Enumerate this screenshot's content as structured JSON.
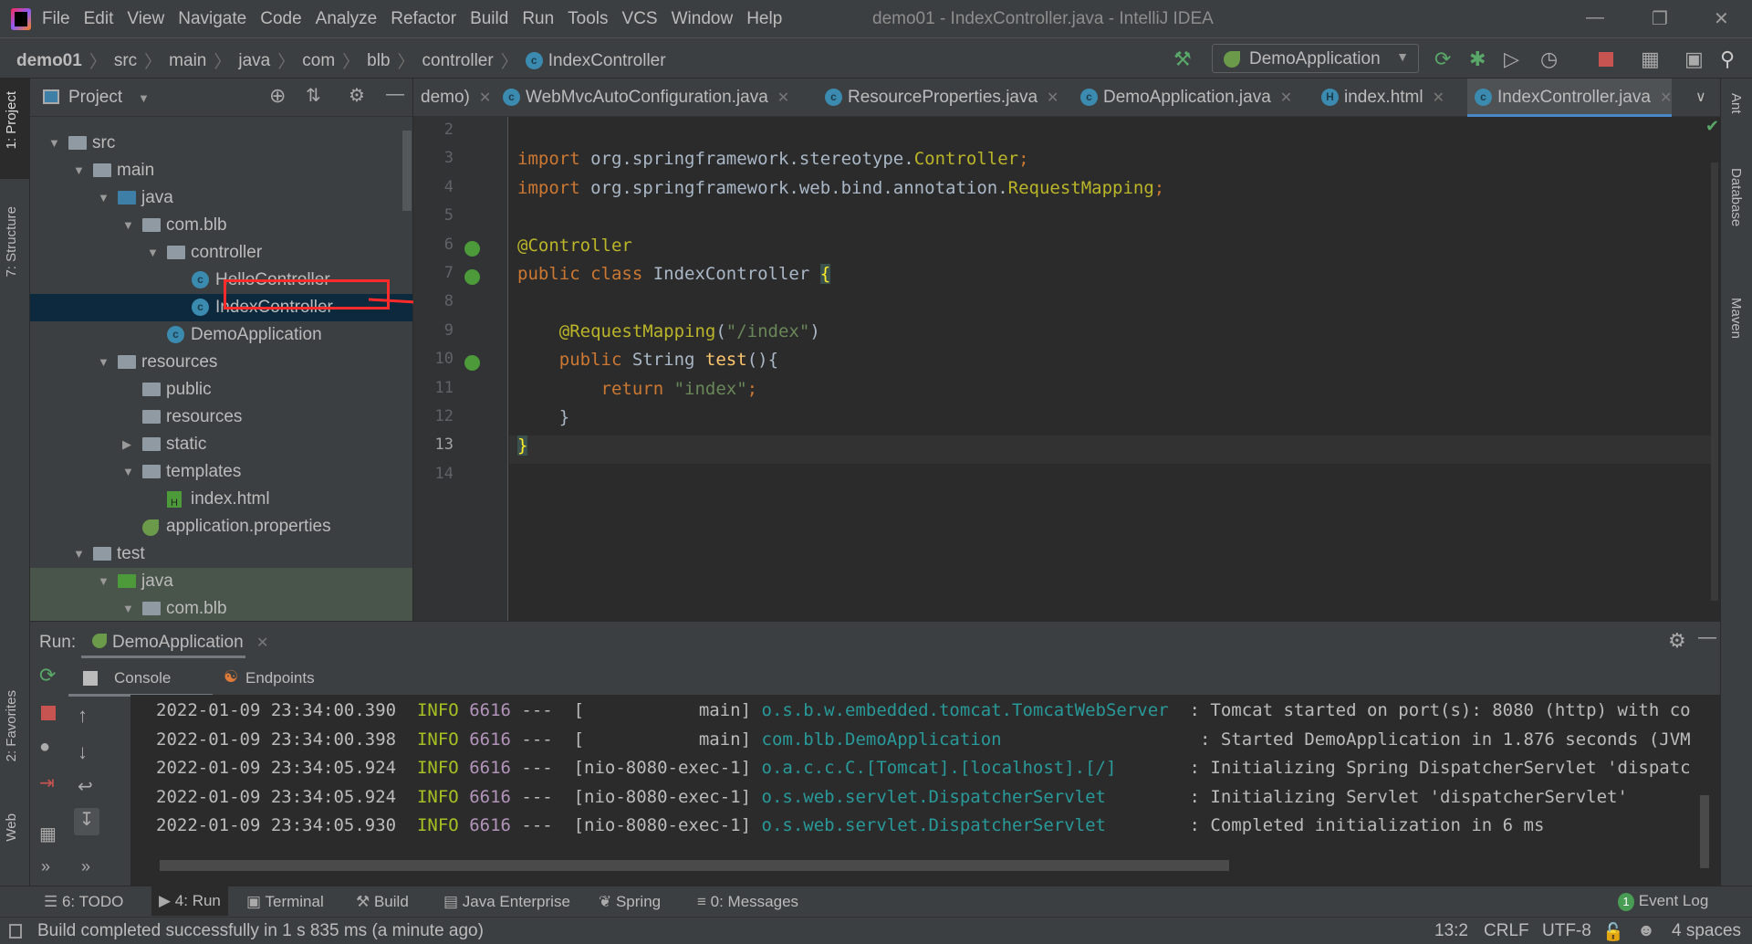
{
  "window": {
    "title": "demo01 - IndexController.java - IntelliJ IDEA"
  },
  "menu": [
    "File",
    "Edit",
    "View",
    "Navigate",
    "Code",
    "Analyze",
    "Refactor",
    "Build",
    "Run",
    "Tools",
    "VCS",
    "Window",
    "Help"
  ],
  "breadcrumb": {
    "project": "demo01",
    "items": [
      "src",
      "main",
      "java",
      "com",
      "blb",
      "controller",
      "IndexController"
    ]
  },
  "toolbar": {
    "run_config": "DemoApplication"
  },
  "left_stripe": {
    "project": "1: Project",
    "structure": "7: Structure",
    "favorites": "2: Favorites",
    "web": "Web"
  },
  "right_stripe": {
    "ant": "Ant",
    "database": "Database",
    "maven": "Maven"
  },
  "project_panel": {
    "title": "Project",
    "tree": [
      {
        "label": "src",
        "level": 0,
        "expanded": true,
        "type": "folder"
      },
      {
        "label": "main",
        "level": 1,
        "expanded": true,
        "type": "folder"
      },
      {
        "label": "java",
        "level": 2,
        "expanded": true,
        "type": "src-folder"
      },
      {
        "label": "com.blb",
        "level": 3,
        "expanded": true,
        "type": "package"
      },
      {
        "label": "controller",
        "level": 4,
        "expanded": true,
        "type": "package"
      },
      {
        "label": "HelloController",
        "level": 5,
        "type": "class"
      },
      {
        "label": "IndexController",
        "level": 5,
        "type": "class",
        "selected": true
      },
      {
        "label": "DemoApplication",
        "level": 4,
        "type": "spring-class"
      },
      {
        "label": "resources",
        "level": 2,
        "expanded": true,
        "type": "res-folder"
      },
      {
        "label": "public",
        "level": 3,
        "type": "folder"
      },
      {
        "label": "resources",
        "level": 3,
        "type": "folder"
      },
      {
        "label": "static",
        "level": 3,
        "expanded": false,
        "type": "folder"
      },
      {
        "label": "templates",
        "level": 3,
        "expanded": true,
        "type": "folder"
      },
      {
        "label": "index.html",
        "level": 4,
        "type": "html"
      },
      {
        "label": "application.properties",
        "level": 3,
        "type": "properties"
      },
      {
        "label": "test",
        "level": 1,
        "expanded": true,
        "type": "folder"
      },
      {
        "label": "java",
        "level": 2,
        "expanded": true,
        "type": "test-folder",
        "test": true
      },
      {
        "label": "com.blb",
        "level": 3,
        "expanded": true,
        "type": "package",
        "test": true
      }
    ]
  },
  "editor": {
    "tabs": [
      {
        "label": "demo)"
      },
      {
        "label": "WebMvcAutoConfiguration.java"
      },
      {
        "label": "ResourceProperties.java"
      },
      {
        "label": "DemoApplication.java"
      },
      {
        "label": "index.html"
      },
      {
        "label": "IndexController.java",
        "active": true
      }
    ],
    "lines": [
      {
        "n": "2",
        "tokens": []
      },
      {
        "n": "3",
        "tokens": [
          [
            "import ",
            "kw"
          ],
          [
            "org.springframework.stereotype.",
            ""
          ],
          [
            "Controller",
            "ann"
          ],
          [
            ";",
            "kw"
          ]
        ]
      },
      {
        "n": "4",
        "tokens": [
          [
            "import ",
            "kw"
          ],
          [
            "org.springframework.web.bind.annotation.",
            ""
          ],
          [
            "RequestMapping",
            "ann"
          ],
          [
            ";",
            "kw"
          ]
        ]
      },
      {
        "n": "5",
        "tokens": []
      },
      {
        "n": "6",
        "tokens": [
          [
            "@Controller",
            "ann"
          ]
        ]
      },
      {
        "n": "7",
        "tokens": [
          [
            "public class ",
            "kw"
          ],
          [
            "IndexController ",
            ""
          ],
          [
            "{",
            "br"
          ]
        ]
      },
      {
        "n": "8",
        "tokens": []
      },
      {
        "n": "9",
        "tokens": [
          [
            "    @RequestMapping",
            "ann"
          ],
          [
            "(",
            ""
          ],
          [
            "\"/index\"",
            "str"
          ],
          [
            ")",
            ""
          ]
        ]
      },
      {
        "n": "10",
        "tokens": [
          [
            "    public ",
            "kw"
          ],
          [
            "String ",
            ""
          ],
          [
            "test",
            "fn"
          ],
          [
            "(){",
            ""
          ]
        ]
      },
      {
        "n": "11",
        "tokens": [
          [
            "        return ",
            "kw"
          ],
          [
            "\"index\"",
            "str"
          ],
          [
            ";",
            "kw"
          ]
        ]
      },
      {
        "n": "12",
        "tokens": [
          [
            "    }",
            ""
          ]
        ]
      },
      {
        "n": "13",
        "tokens": [
          [
            "}",
            "br"
          ]
        ],
        "current": true
      },
      {
        "n": "14",
        "tokens": []
      }
    ]
  },
  "run_panel": {
    "label": "Run:",
    "config_tab": "DemoApplication",
    "tabs": [
      "Console",
      "Endpoints"
    ],
    "console": [
      {
        "ts": "2022-01-09 23:34:00.390",
        "level": "INFO",
        "pid": "6616",
        "thread": "---  [           main]",
        "logger": "o.s.b.w.embedded.tomcat.TomcatWebServer ",
        "msg": " : Tomcat started on port(s): 8080 (http) with co"
      },
      {
        "ts": "2022-01-09 23:34:00.398",
        "level": "INFO",
        "pid": "6616",
        "thread": "---  [           main]",
        "logger": "com.blb.DemoApplication                  ",
        "msg": " : Started DemoApplication in 1.876 seconds (JVM"
      },
      {
        "ts": "2022-01-09 23:34:05.924",
        "level": "INFO",
        "pid": "6616",
        "thread": "---  [nio-8080-exec-1]",
        "logger": "o.a.c.c.C.[Tomcat].[localhost].[/]      ",
        "msg": " : Initializing Spring DispatcherServlet 'dispatc"
      },
      {
        "ts": "2022-01-09 23:34:05.924",
        "level": "INFO",
        "pid": "6616",
        "thread": "---  [nio-8080-exec-1]",
        "logger": "o.s.web.servlet.DispatcherServlet       ",
        "msg": " : Initializing Servlet 'dispatcherServlet'"
      },
      {
        "ts": "2022-01-09 23:34:05.930",
        "level": "INFO",
        "pid": "6616",
        "thread": "---  [nio-8080-exec-1]",
        "logger": "o.s.web.servlet.DispatcherServlet       ",
        "msg": " : Completed initialization in 6 ms"
      }
    ]
  },
  "bottom_tabs": [
    {
      "label": "6: TODO"
    },
    {
      "label": "4: Run",
      "active": true
    },
    {
      "label": "Terminal"
    },
    {
      "label": "Build"
    },
    {
      "label": "Java Enterprise"
    },
    {
      "label": "Spring"
    },
    {
      "label": "0: Messages"
    }
  ],
  "event_log": {
    "count": "1",
    "label": "Event Log"
  },
  "status": {
    "message": "Build completed successfully in 1 s 835 ms (a minute ago)",
    "position": "13:2",
    "line_sep": "CRLF",
    "encoding": "UTF-8",
    "indent": "4 spaces"
  },
  "colors": {
    "accent": "#4a88c7",
    "selection": "#0d293e",
    "annotation_box": "#ff2a2a"
  }
}
